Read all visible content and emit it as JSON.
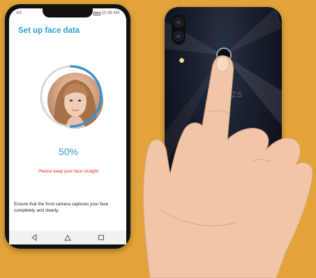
{
  "status_bar": {
    "left": "4G",
    "time": "10:36 AM"
  },
  "screen": {
    "title": "Set up face data",
    "progress": {
      "percent_text": "50%",
      "fraction": 0.5
    },
    "warning": "Please keep your face straight",
    "instruction": "Ensure that the front camera captures your face completely and clearly."
  },
  "back_phone": {
    "logo": "ZS"
  },
  "colors": {
    "background": "#e2a43a",
    "title": "#2a9fd0",
    "progress": "#3a8fd0",
    "warning": "#e02b1f"
  },
  "icons": {
    "nav_back": "back-triangle-icon",
    "nav_home": "home-icon",
    "nav_recents": "recents-square-icon"
  }
}
